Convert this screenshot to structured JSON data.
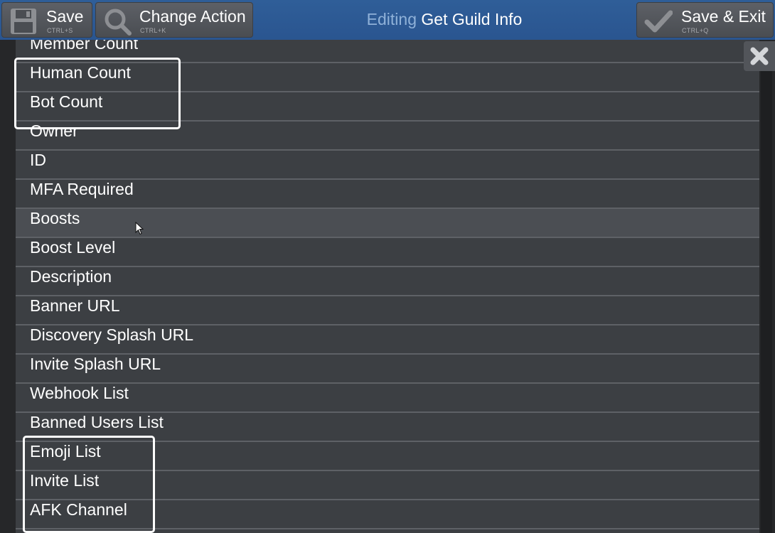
{
  "toolbar": {
    "save": {
      "label": "Save",
      "shortcut": "CTRL+S",
      "icon": "floppy-disk-icon"
    },
    "change_action": {
      "label": "Change Action",
      "shortcut": "CTRL+K",
      "icon": "magnifier-icon"
    },
    "save_exit": {
      "label": "Save & Exit",
      "shortcut": "CTRL+Q",
      "icon": "checkmark-icon"
    }
  },
  "title": {
    "prefix": "Editing",
    "name": "Get Guild Info"
  },
  "close_icon": "close-x-icon",
  "list": {
    "hovered_item": "Boosts",
    "highlighted_groups": [
      [
        "Human Count",
        "Bot Count"
      ],
      [
        "Emoji List",
        "Invite List",
        "AFK Channel"
      ]
    ],
    "items": [
      "Member Count",
      "Human Count",
      "Bot Count",
      "Owner",
      "ID",
      "MFA Required",
      "Boosts",
      "Boost Level",
      "Description",
      "Banner URL",
      "Discovery Splash URL",
      "Invite Splash URL",
      "Webhook List",
      "Banned Users List",
      "Emoji List",
      "Invite List",
      "AFK Channel"
    ]
  },
  "colors": {
    "header": "#2a5590",
    "row": "#3c3f43",
    "row_hover": "#4b4e53",
    "title_prefix": "#8fb1d8",
    "highlight_border": "#ffffff"
  }
}
